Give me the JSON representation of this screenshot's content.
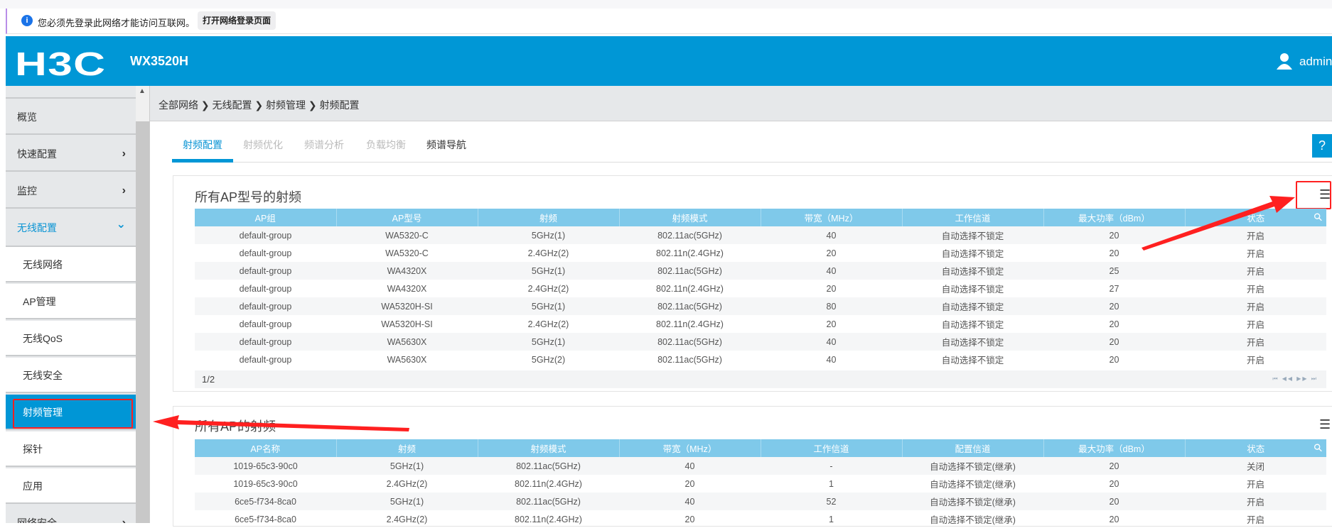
{
  "notice": {
    "message": "您必须先登录此网络才能访问互联网。",
    "button": "打开网络登录页面"
  },
  "header": {
    "logo": "H3C",
    "model": "WX3520H",
    "user": "admin"
  },
  "sidebar": {
    "items": [
      {
        "label": "概览",
        "chevron": ""
      },
      {
        "label": "快速配置",
        "chevron": "›"
      },
      {
        "label": "监控",
        "chevron": "›"
      },
      {
        "label": "无线配置",
        "chevron": "⌄"
      },
      {
        "label": "无线网络"
      },
      {
        "label": "AP管理"
      },
      {
        "label": "无线QoS"
      },
      {
        "label": "无线安全"
      },
      {
        "label": "射频管理"
      },
      {
        "label": "探针"
      },
      {
        "label": "应用"
      },
      {
        "label": "网络安全",
        "chevron": "›"
      }
    ]
  },
  "breadcrumb": "全部网络 ❯ 无线配置 ❯ 射频管理 ❯ 射频配置",
  "tabs": [
    "射频配置",
    "射频优化",
    "频谱分析",
    "负载均衡",
    "频谱导航"
  ],
  "help": "?",
  "table1": {
    "title": "所有AP型号的射频",
    "columns": [
      "AP组",
      "AP型号",
      "射频",
      "射频模式",
      "带宽（MHz）",
      "工作信道",
      "最大功率（dBm）",
      "状态"
    ],
    "rows": [
      [
        "default-group",
        "WA5320-C",
        "5GHz(1)",
        "802.11ac(5GHz)",
        "40",
        "自动选择不锁定",
        "20",
        "开启"
      ],
      [
        "default-group",
        "WA5320-C",
        "2.4GHz(2)",
        "802.11n(2.4GHz)",
        "20",
        "自动选择不锁定",
        "20",
        "开启"
      ],
      [
        "default-group",
        "WA4320X",
        "5GHz(1)",
        "802.11ac(5GHz)",
        "40",
        "自动选择不锁定",
        "25",
        "开启"
      ],
      [
        "default-group",
        "WA4320X",
        "2.4GHz(2)",
        "802.11n(2.4GHz)",
        "20",
        "自动选择不锁定",
        "27",
        "开启"
      ],
      [
        "default-group",
        "WA5320H-SI",
        "5GHz(1)",
        "802.11ac(5GHz)",
        "80",
        "自动选择不锁定",
        "20",
        "开启"
      ],
      [
        "default-group",
        "WA5320H-SI",
        "2.4GHz(2)",
        "802.11n(2.4GHz)",
        "20",
        "自动选择不锁定",
        "20",
        "开启"
      ],
      [
        "default-group",
        "WA5630X",
        "5GHz(1)",
        "802.11ac(5GHz)",
        "40",
        "自动选择不锁定",
        "20",
        "开启"
      ],
      [
        "default-group",
        "WA5630X",
        "5GHz(2)",
        "802.11ac(5GHz)",
        "40",
        "自动选择不锁定",
        "20",
        "开启"
      ]
    ],
    "page": "1/2",
    "pager": "⏮ ◀◀ ▶▶ ⏭"
  },
  "table2": {
    "title": "所有AP的射频",
    "columns": [
      "AP名称",
      "射频",
      "射频模式",
      "带宽（MHz）",
      "工作信道",
      "配置信道",
      "最大功率（dBm）",
      "状态"
    ],
    "rows": [
      [
        "1019-65c3-90c0",
        "5GHz(1)",
        "802.11ac(5GHz)",
        "40",
        "-",
        "自动选择不锁定(继承)",
        "20",
        "关闭"
      ],
      [
        "1019-65c3-90c0",
        "2.4GHz(2)",
        "802.11n(2.4GHz)",
        "20",
        "1",
        "自动选择不锁定(继承)",
        "20",
        "开启"
      ],
      [
        "6ce5-f734-8ca0",
        "5GHz(1)",
        "802.11ac(5GHz)",
        "40",
        "52",
        "自动选择不锁定(继承)",
        "20",
        "开启"
      ],
      [
        "6ce5-f734-8ca0",
        "2.4GHz(2)",
        "802.11n(2.4GHz)",
        "20",
        "1",
        "自动选择不锁定(继承)",
        "20",
        "开启"
      ]
    ]
  },
  "colors": {
    "brand": "#0097d6",
    "table_header": "#7fc9ea",
    "annotation": "#ff2020"
  }
}
